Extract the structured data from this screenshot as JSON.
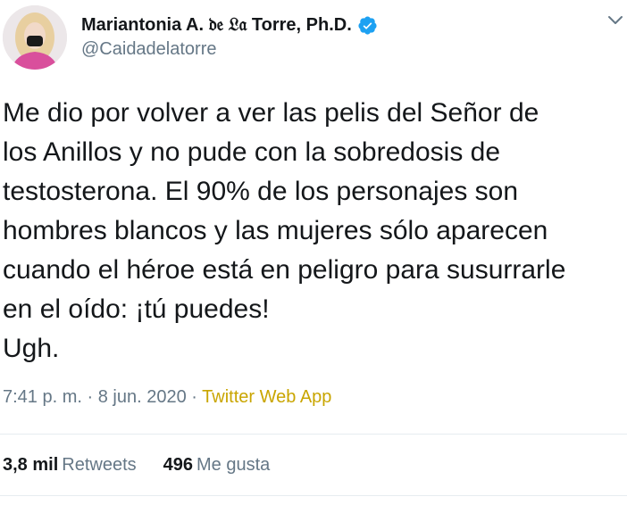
{
  "author": {
    "display_name": "Mariantonia A. ",
    "display_name_styled": "𝔡𝔢 𝔏𝔞",
    "display_name_suffix": " Torre, Ph.D.",
    "handle": "@Caidadelatorre",
    "verified": true,
    "verified_color": "#1da1f2"
  },
  "tweet": {
    "text_lines": [
      "Me dio por volver a ver las pelis del Señor de",
      "los Anillos y no pude con la sobredosis de",
      "testosterona. El 90% de los personajes son",
      "hombres blancos y las mujeres sólo aparecen",
      "cuando el héroe está en peligro para susurrarle",
      "en el oído: ¡tú puedes!",
      "Ugh."
    ],
    "time": "7:41 p. m.",
    "separator": "·",
    "date": "8 jun. 2020",
    "source": "Twitter Web App",
    "source_color": "#c9a500"
  },
  "stats": {
    "retweets_count": "3,8 mil",
    "retweets_label": "Retweets",
    "likes_count": "496",
    "likes_label": "Me gusta"
  },
  "icons": {
    "verified": "verified-badge-icon",
    "more": "chevron-down-icon"
  }
}
